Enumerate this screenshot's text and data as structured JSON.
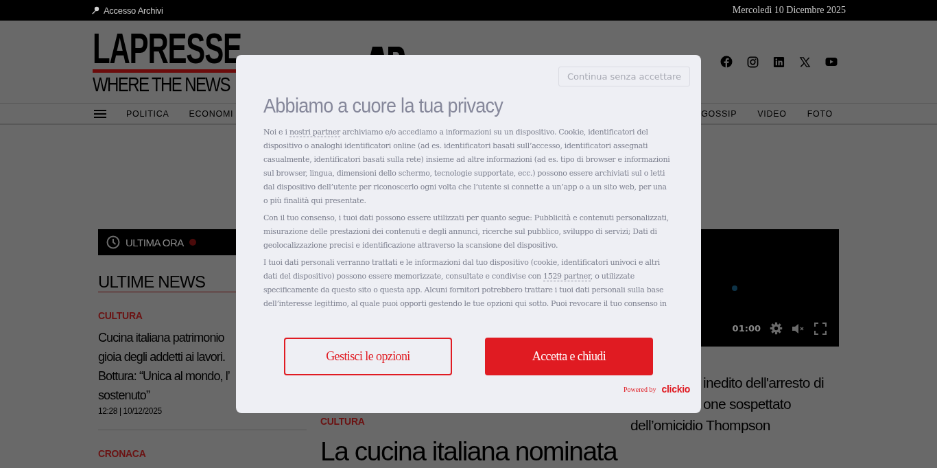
{
  "top_bar": {
    "archive_link": "Accesso Archivi",
    "date": "Mercoledì 10 Dicembre 2025"
  },
  "header": {
    "logo": "LAPRESSE",
    "tagline": "WHERE THE NEWS"
  },
  "nav": {
    "left": [
      "POLITICA",
      "ECONOMI"
    ],
    "right": [
      "GOSSIP",
      "VIDEO",
      "FOTO"
    ]
  },
  "breaking": {
    "label": "ULTIMA ORA"
  },
  "latest": {
    "heading": "ULTIME NEWS",
    "items": [
      {
        "category": "CULTURA",
        "title_lines": [
          "Cucina italiana patrimonio",
          "gioia degli addetti ai lavori.",
          "Bottura: “Unica al mondo, l’",
          "sostenuto”"
        ],
        "time": "12:28 | 10/12/2025"
      },
      {
        "category": "CRONACA"
      }
    ]
  },
  "main_story": {
    "category": "CULTURA",
    "title": "La cucina italiana nominata"
  },
  "video": {
    "duration": "01:00",
    "muted": true,
    "caption_lines": [
      "inedito dell'arresto di",
      "one sospettato",
      "dell’omicidio Thompson"
    ]
  },
  "consent": {
    "skip_button": "Continua senza accettare",
    "title": "Abbiamo a cuore la tua privacy",
    "paragraphs": [
      [
        {
          "kind": "text",
          "text": "Noi e i "
        },
        {
          "kind": "link",
          "text": "nostri partner"
        },
        {
          "kind": "text",
          "text": " archiviamo e/o accediamo a informazioni su un dispositivo. Cookie, identificatori del dispositivo o analoghi identificatori online (ad es. identificatori basati sull’accesso, identificatori assegnati casualmente, identificatori basati sulla rete) insieme ad altre informazioni (ad es. tipo di browser e informazioni sul browser, lingua, dimensioni dello schermo, tecnologie supportate, ecc.) possono essere archiviati sul o letti dal dispositivo dell’utente per riconoscerlo ogni volta che l’utente si connette a un’app o a un sito web, per una o più finalità qui presentate."
        }
      ],
      [
        {
          "kind": "text",
          "text": "Con il tuo consenso, i tuoi dati possono essere utilizzati per quanto segue: Pubblicità e contenuti personalizzati, misurazione delle prestazioni dei contenuti e degli annunci, ricerche sul pubblico, sviluppo di servizi; Dati di geolocalizzazione precisi e identificazione attraverso la scansione del dispositivo."
        }
      ],
      [
        {
          "kind": "text",
          "text": "I tuoi dati personali verranno trattati e le informazioni dal tuo dispositivo (cookie, identificatori univoci e altri dati del dispositivo) possono essere memorizzate, consultate e condivise con "
        },
        {
          "kind": "link",
          "text": "1529 partner"
        },
        {
          "kind": "text",
          "text": ", o utilizzate specificamente da questo sito o questa app. Alcuni fornitori potrebbero trattare i tuoi dati personali sulla base dell’interesse legittimo, al quale puoi opporti gestendo le tue opzioni qui sotto. Puoi revocare il tuo consenso in"
        }
      ]
    ],
    "manage_button": "Gestisci le opzioni",
    "accept_button": "Accetta e chiudi",
    "powered_by": "Powered by",
    "brand": "clickio"
  }
}
